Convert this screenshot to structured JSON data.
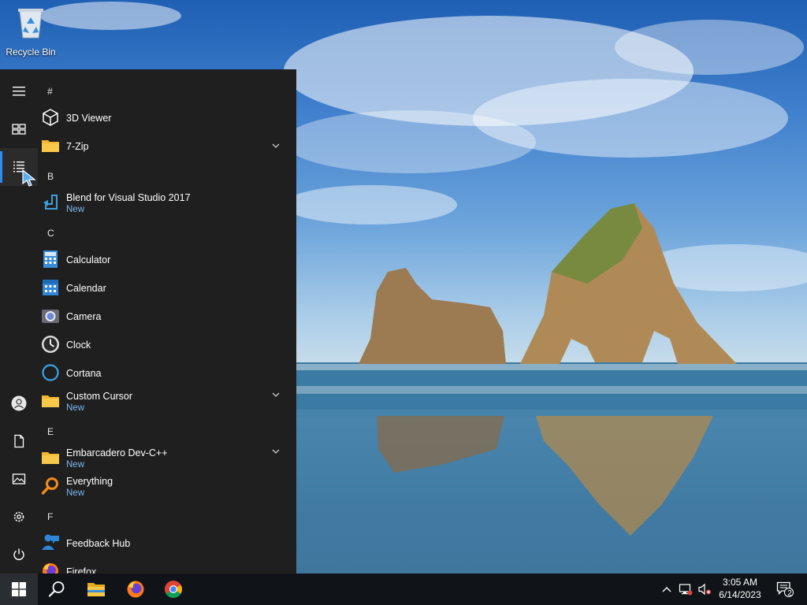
{
  "desktop": {
    "recycle_bin_label": "Recycle Bin"
  },
  "start_menu": {
    "rail": [
      {
        "icon": "hamburger-menu-icon"
      },
      {
        "icon": "tiles-icon"
      },
      {
        "icon": "all-apps-list-icon"
      },
      {
        "icon": "user-account-icon"
      },
      {
        "icon": "documents-icon"
      },
      {
        "icon": "pictures-icon"
      },
      {
        "icon": "settings-gear-icon"
      },
      {
        "icon": "power-icon"
      }
    ],
    "letters": {
      "hash": "#",
      "b": "B",
      "c": "C",
      "e": "E",
      "f": "F"
    },
    "apps": {
      "viewer3d": {
        "name": "3D Viewer",
        "icon": "cube-icon"
      },
      "zip7": {
        "name": "7-Zip",
        "icon": "folder-icon"
      },
      "blend": {
        "name": "Blend for Visual Studio 2017",
        "sub": "New",
        "icon": "blend-icon"
      },
      "calculator": {
        "name": "Calculator",
        "icon": "calculator-icon"
      },
      "calendar": {
        "name": "Calendar",
        "icon": "calendar-icon"
      },
      "camera": {
        "name": "Camera",
        "icon": "camera-icon"
      },
      "clock": {
        "name": "Clock",
        "icon": "clock-icon"
      },
      "cortana": {
        "name": "Cortana",
        "icon": "cortana-icon"
      },
      "custom_cursor": {
        "name": "Custom Cursor",
        "sub": "New",
        "icon": "folder-icon"
      },
      "devcpp": {
        "name": "Embarcadero Dev-C++",
        "sub": "New",
        "icon": "folder-icon"
      },
      "everything": {
        "name": "Everything",
        "sub": "New",
        "icon": "magnifier-icon"
      },
      "feedback": {
        "name": "Feedback Hub",
        "icon": "feedback-hub-icon"
      },
      "firefox": {
        "name": "Firefox",
        "icon": "firefox-icon"
      }
    }
  },
  "taskbar": {
    "clock_time": "3:05 AM",
    "clock_date": "6/14/2023",
    "notification_count": "2",
    "pinned": [
      {
        "icon": "search-icon"
      },
      {
        "icon": "file-explorer-icon"
      },
      {
        "icon": "firefox-icon"
      },
      {
        "icon": "chrome-icon"
      }
    ]
  },
  "colors": {
    "start_bg": "#1f1f1f",
    "taskbar_bg": "#101418",
    "accent": "#2d8ef0",
    "new_label": "#7cb8f0"
  }
}
